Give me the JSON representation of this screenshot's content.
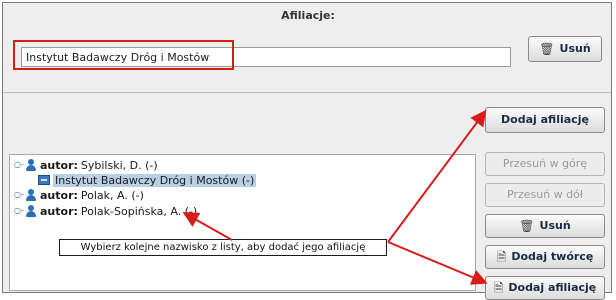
{
  "header": {
    "title": "Afiliacje:"
  },
  "affiliation_field": {
    "value": "Instytut Badawczy Dróg i Mostów"
  },
  "buttons": {
    "remove_top": "Usuń",
    "add_affiliation_top": "Dodaj afiliację",
    "move_up": "Przesuń w górę",
    "move_down": "Przesuń w dół",
    "remove": "Usuń",
    "add_author": "Dodaj twórcę",
    "add_affiliation_bottom": "Dodaj afiliację"
  },
  "tree": {
    "author_prefix": "autor:",
    "items": [
      {
        "author": "Sybilski, D. (-)",
        "expanded": true
      },
      {
        "affiliation": "Instytut Badawczy Dróg i Mostów (-)"
      },
      {
        "author": "Polak, A. (-)",
        "expanded": false
      },
      {
        "author": "Polak-Sopińska, A. (-)",
        "expanded": false
      }
    ]
  },
  "tooltip": {
    "text": "Wybierz kolejne nazwisko z listy, aby dodać jego afiliację"
  },
  "colors": {
    "annotation": "#d81b1b",
    "selection": "#b8cfe5",
    "icon_blue": "#2b6fb8"
  },
  "icons": [
    "trash-icon",
    "person-icon",
    "institution-icon",
    "add-document-icon"
  ]
}
